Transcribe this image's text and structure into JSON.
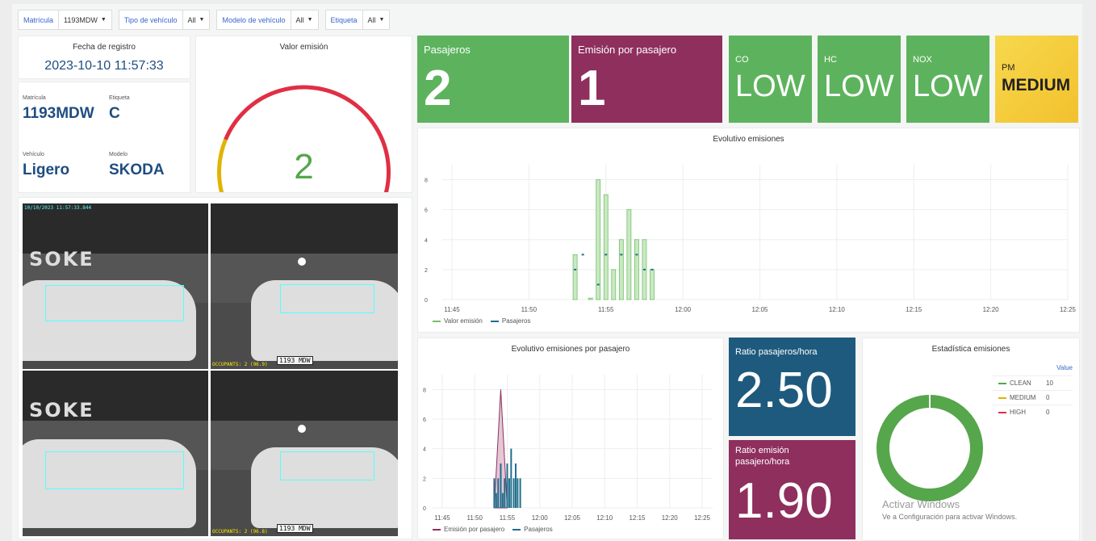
{
  "variables": [
    {
      "label": "Matrícula",
      "value": "1193MDW"
    },
    {
      "label": "Tipo de vehículo",
      "value": "All"
    },
    {
      "label": "Modelo de vehículo",
      "value": "All"
    },
    {
      "label": "Etiqueta",
      "value": "All"
    }
  ],
  "registro": {
    "title": "Fecha de registro",
    "value": "2023-10-10 11:57:33"
  },
  "vehicle": {
    "matricula_label": "Matrícula",
    "matricula": "1193MDW",
    "etiqueta_label": "Etiqueta",
    "etiqueta": "C",
    "vehiculo_label": "Vehículo",
    "vehiculo": "Ligero",
    "modelo_label": "Modelo",
    "modelo": "SKODA"
  },
  "gauge": {
    "title": "Valor emisión",
    "value": "2",
    "value_num": 2,
    "max": 10
  },
  "stats": {
    "pasajeros": {
      "title": "Pasajeros",
      "value": "2",
      "color": "#5db35d"
    },
    "emision_pasajero": {
      "title": "Emisión por pasajero",
      "value": "1",
      "color": "#8e2f5e"
    },
    "co": {
      "title": "CO",
      "value": "LOW",
      "color": "#5db35d"
    },
    "hc": {
      "title": "HC",
      "value": "LOW",
      "color": "#5db35d"
    },
    "nox": {
      "title": "NOX",
      "value": "LOW",
      "color": "#5db35d"
    },
    "pm": {
      "title": "PM",
      "value": "MEDIUM",
      "color": "#f2c12e"
    },
    "ratio_pasajeros": {
      "title": "Ratio pasajeros/hora",
      "value": "2.50",
      "color": "#1e5a7d"
    },
    "ratio_emision": {
      "title": "Ratio emisión pasajero/hora",
      "value": "1.90",
      "color": "#8e2f5e"
    }
  },
  "camera": {
    "timestamp": "10/10/2023 11:57:33.844",
    "occupants_1": "OCCUPANTS: 2 (96.9)",
    "occupants_2": "OCCUPANTS: 2 (96.8)",
    "plate": "1193 MDW",
    "graffiti": "SOKE"
  },
  "watermark": {
    "title": "Activar Windows",
    "subtitle": "Ve a Configuración para activar Windows."
  },
  "chart_data": [
    {
      "type": "bar",
      "title": "Evolutivo emisiones",
      "x_ticks": [
        "11:45",
        "11:50",
        "11:55",
        "12:00",
        "12:05",
        "12:10",
        "12:15",
        "12:20",
        "12:25"
      ],
      "y_ticks": [
        "0",
        "2",
        "4",
        "6",
        "8"
      ],
      "ylim": [
        0,
        9
      ],
      "series": [
        {
          "name": "Valor emisión",
          "color": "#73bf69",
          "points": [
            [
              "11:53",
              3
            ],
            [
              "11:54",
              0.1
            ],
            [
              "11:54.5",
              8
            ],
            [
              "11:55",
              7
            ],
            [
              "11:55.5",
              2
            ],
            [
              "11:56",
              4
            ],
            [
              "11:56.5",
              6
            ],
            [
              "11:57",
              4
            ],
            [
              "11:57.5",
              4
            ],
            [
              "11:58",
              2
            ]
          ]
        },
        {
          "name": "Pasajeros",
          "color": "#1f6e8c",
          "points": [
            [
              "11:53",
              2
            ],
            [
              "11:53.5",
              3
            ],
            [
              "11:54.5",
              1
            ],
            [
              "11:55",
              3
            ],
            [
              "11:56",
              3
            ],
            [
              "11:57",
              3
            ],
            [
              "11:57.5",
              2
            ],
            [
              "11:58",
              2
            ]
          ]
        }
      ]
    },
    {
      "type": "line",
      "title": "Evolutivo emisiones por pasajero",
      "x_ticks": [
        "11:45",
        "11:50",
        "11:55",
        "12:00",
        "12:05",
        "12:10",
        "12:15",
        "12:20",
        "12:25"
      ],
      "y_ticks": [
        "0",
        "2",
        "4",
        "6",
        "8"
      ],
      "ylim": [
        0,
        9
      ],
      "series": [
        {
          "name": "Emisión por pasajero",
          "color": "#8e2f5e",
          "points": [
            [
              "11:53",
              0
            ],
            [
              "11:54",
              8
            ],
            [
              "11:55",
              0
            ]
          ]
        },
        {
          "name": "Pasajeros",
          "color": "#1f6e8c",
          "points": [
            [
              "11:53",
              2
            ],
            [
              "11:53.3",
              1
            ],
            [
              "11:53.6",
              2
            ],
            [
              "11:54",
              3
            ],
            [
              "11:54.3",
              1
            ],
            [
              "11:54.6",
              2
            ],
            [
              "11:55",
              3
            ],
            [
              "11:55.3",
              2
            ],
            [
              "11:55.6",
              4
            ],
            [
              "11:56",
              2
            ],
            [
              "11:56.3",
              3
            ],
            [
              "11:56.6",
              2
            ],
            [
              "11:57",
              2
            ]
          ]
        }
      ]
    },
    {
      "type": "pie",
      "title": "Estadística emisiones",
      "legend_header": "Value",
      "slices": [
        {
          "name": "CLEAN",
          "value": 10,
          "color": "#56a64b"
        },
        {
          "name": "MEDIUM",
          "value": 0,
          "color": "#e0b400"
        },
        {
          "name": "HIGH",
          "value": 0,
          "color": "#e02f44"
        }
      ]
    }
  ]
}
